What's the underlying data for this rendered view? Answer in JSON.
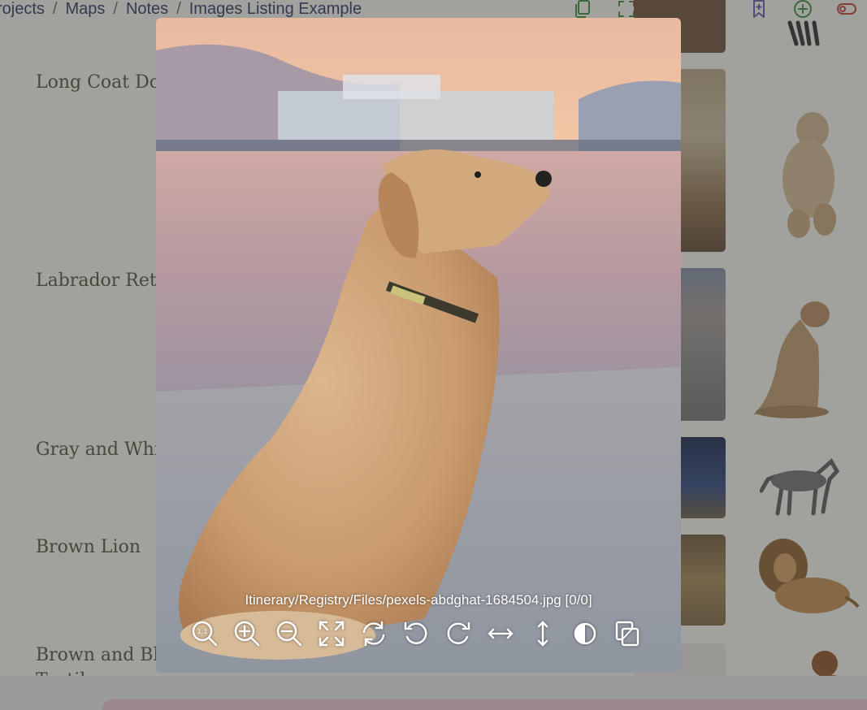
{
  "breadcrumb": {
    "items": [
      "rojects",
      "Maps",
      "Notes",
      "Images Listing Example"
    ],
    "separator": "/"
  },
  "toolbar": {
    "icons": [
      "copy-icon",
      "fullscreen-icon",
      "close-icon",
      "trash-icon",
      "bookmark-add-icon",
      "add-circle-icon",
      "toggle-icon"
    ],
    "colors": {
      "copy": "#2e8b2e",
      "fullscreen": "#2e8b2e",
      "close": "#c0392b",
      "trash": "#c0392b",
      "bookmark": "#6a4fa8",
      "add": "#2e8b2e",
      "toggle": "#c0392b"
    }
  },
  "rows": [
    {
      "label": "Long Coat Dog"
    },
    {
      "label": "Labrador Retriever"
    },
    {
      "label": "Gray and White Wolf"
    },
    {
      "label": "Brown Lion"
    },
    {
      "label": "Brown and Black Textile"
    }
  ],
  "labels_visible": {
    "row1": "Long Coat Dog",
    "row2": "Labrador Retri",
    "row3": "Gray and Whit",
    "row4": "Brown Lion",
    "row5_line1": "Brown and Bla",
    "row5_line2": "Textile"
  },
  "viewer": {
    "caption": "Itinerary/Registry/Files/pexels-abdghat-1684504.jpg [0/0]",
    "tools": [
      "zoom-reset-icon",
      "zoom-in-icon",
      "zoom-out-icon",
      "fit-screen-icon",
      "rotate-icon",
      "rotate-left-icon",
      "rotate-right-icon",
      "flip-horizontal-icon",
      "flip-vertical-icon",
      "invert-colors-icon",
      "copy-image-icon"
    ],
    "reset_glyph": "1:1"
  }
}
